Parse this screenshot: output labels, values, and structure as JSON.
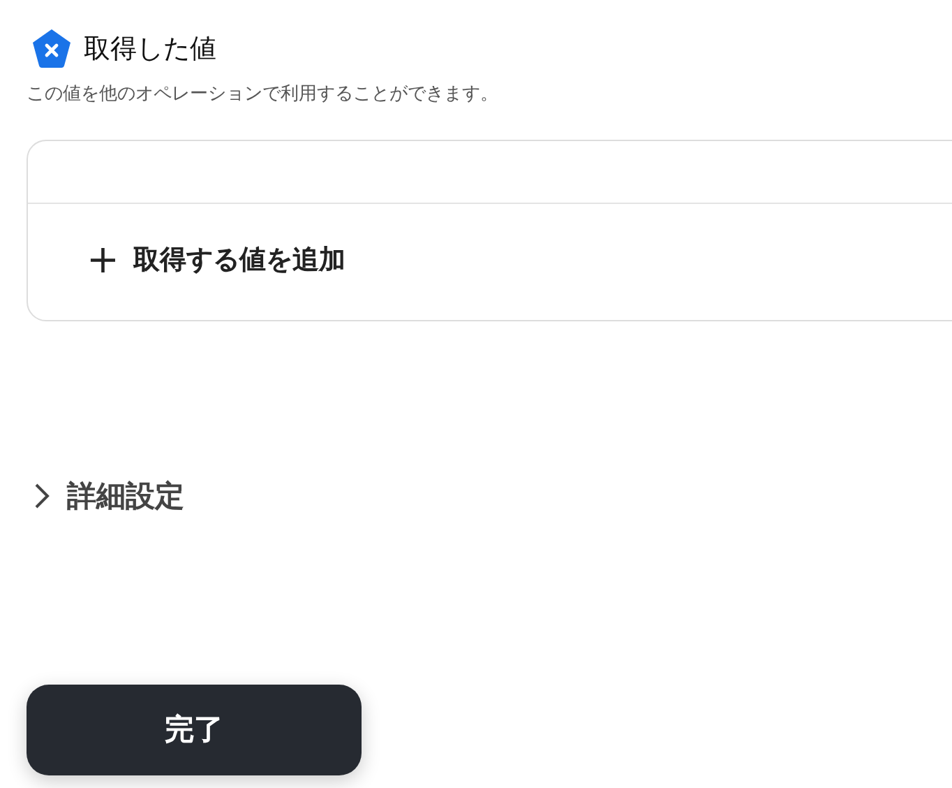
{
  "section": {
    "title": "取得した値",
    "description": "この値を他のオペレーションで利用することができます。"
  },
  "values_card": {
    "add_button": {
      "icon": "+",
      "label": "取得する値を追加"
    }
  },
  "advanced_settings": {
    "label": "詳細設定",
    "expanded": false
  },
  "done_button": {
    "label": "完了"
  }
}
